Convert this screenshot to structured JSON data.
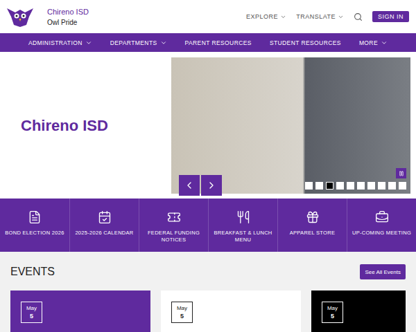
{
  "header": {
    "title": "Chireno ISD",
    "subtitle": "Owl Pride",
    "utility": [
      {
        "label": "EXPLORE",
        "dropdown": true
      },
      {
        "label": "TRANSLATE",
        "dropdown": true
      }
    ],
    "sign_in": "SIGN IN"
  },
  "nav": [
    {
      "label": "ADMINISTRATION",
      "dropdown": true
    },
    {
      "label": "DEPARTMENTS",
      "dropdown": true
    },
    {
      "label": "PARENT RESOURCES",
      "dropdown": false
    },
    {
      "label": "STUDENT RESOURCES",
      "dropdown": false
    },
    {
      "label": "MORE",
      "dropdown": true
    }
  ],
  "hero": {
    "title": "Chireno ISD",
    "playing": true,
    "slides": [
      {
        "selected": false
      },
      {
        "selected": false
      },
      {
        "selected": true
      },
      {
        "selected": false
      },
      {
        "selected": false
      },
      {
        "selected": false
      },
      {
        "selected": false
      },
      {
        "selected": false
      },
      {
        "selected": false
      },
      {
        "selected": false
      }
    ]
  },
  "quick_links": [
    {
      "label": "BOND ELECTION 2026"
    },
    {
      "label": "2025-2026 CALENDAR"
    },
    {
      "label": "FEDERAL FUNDING NOTICES"
    },
    {
      "label": "BREAKFAST & LUNCH MENU"
    },
    {
      "label": "APPAREL STORE"
    },
    {
      "label": "UP-COMING MEETING"
    }
  ],
  "events": {
    "title": "EVENTS",
    "see_all": "See All Events",
    "cards": [
      {
        "month": "May",
        "day": "5",
        "color": "#5f2a9e"
      },
      {
        "month": "May",
        "day": "5",
        "color": "#ffffff"
      },
      {
        "month": "May",
        "day": "5",
        "color": "#000000"
      }
    ]
  }
}
